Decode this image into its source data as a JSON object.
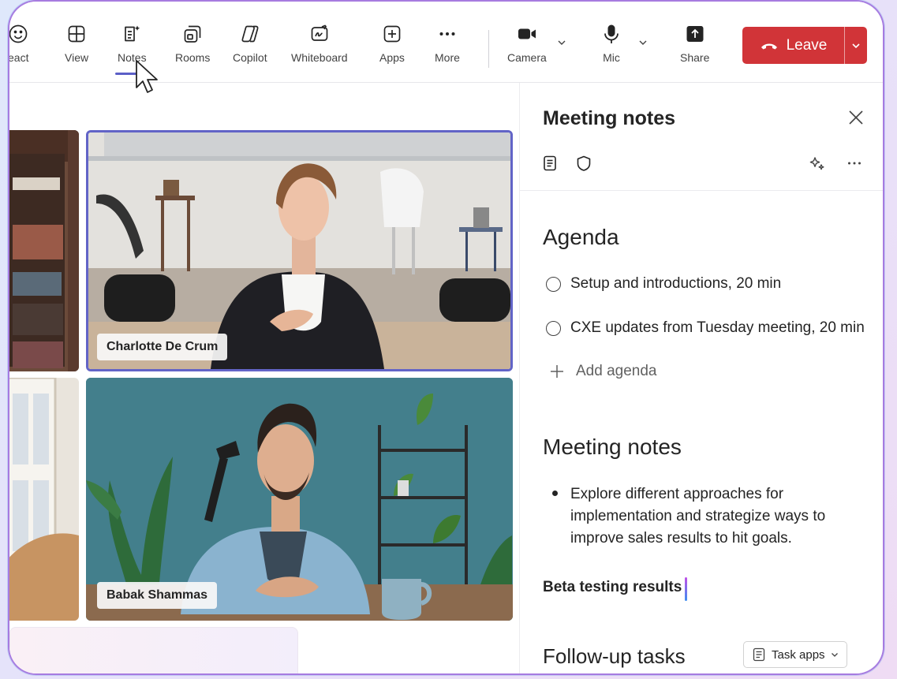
{
  "toolbar": {
    "items": [
      {
        "label": "eact",
        "icon": "emoji-react-icon"
      },
      {
        "label": "View",
        "icon": "grid-view-icon"
      },
      {
        "label": "Notes",
        "icon": "notes-sparkle-icon"
      },
      {
        "label": "Rooms",
        "icon": "rooms-icon"
      },
      {
        "label": "Copilot",
        "icon": "copilot-icon"
      },
      {
        "label": "Whiteboard",
        "icon": "whiteboard-icon"
      },
      {
        "label": "Apps",
        "icon": "add-apps-icon"
      },
      {
        "label": "More",
        "icon": "more-dots-icon"
      },
      {
        "label": "Camera",
        "icon": "camera-icon"
      },
      {
        "label": "Mic",
        "icon": "mic-icon"
      },
      {
        "label": "Share",
        "icon": "share-upload-icon"
      }
    ],
    "leave_label": "Leave",
    "leave_color": "#d13438",
    "active_tab": "Notes",
    "accent_color": "#5b5fc7"
  },
  "participants": [
    {
      "name": "Charlotte De Crum",
      "active_speaker": true
    },
    {
      "name": "Babak Shammas",
      "active_speaker": false
    }
  ],
  "panel": {
    "title": "Meeting notes",
    "agenda_heading": "Agenda",
    "agenda_items": [
      "Setup and introductions, 20 min",
      "CXE updates from Tuesday meeting, 20 min"
    ],
    "add_agenda_label": "Add agenda",
    "notes_heading": "Meeting notes",
    "notes_bullets": [
      "Explore different approaches for implementation and strategize ways to improve sales results to hit goals."
    ],
    "beta_heading": "Beta testing results",
    "followup_heading": "Follow-up tasks",
    "task_apps_label": "Task apps"
  }
}
